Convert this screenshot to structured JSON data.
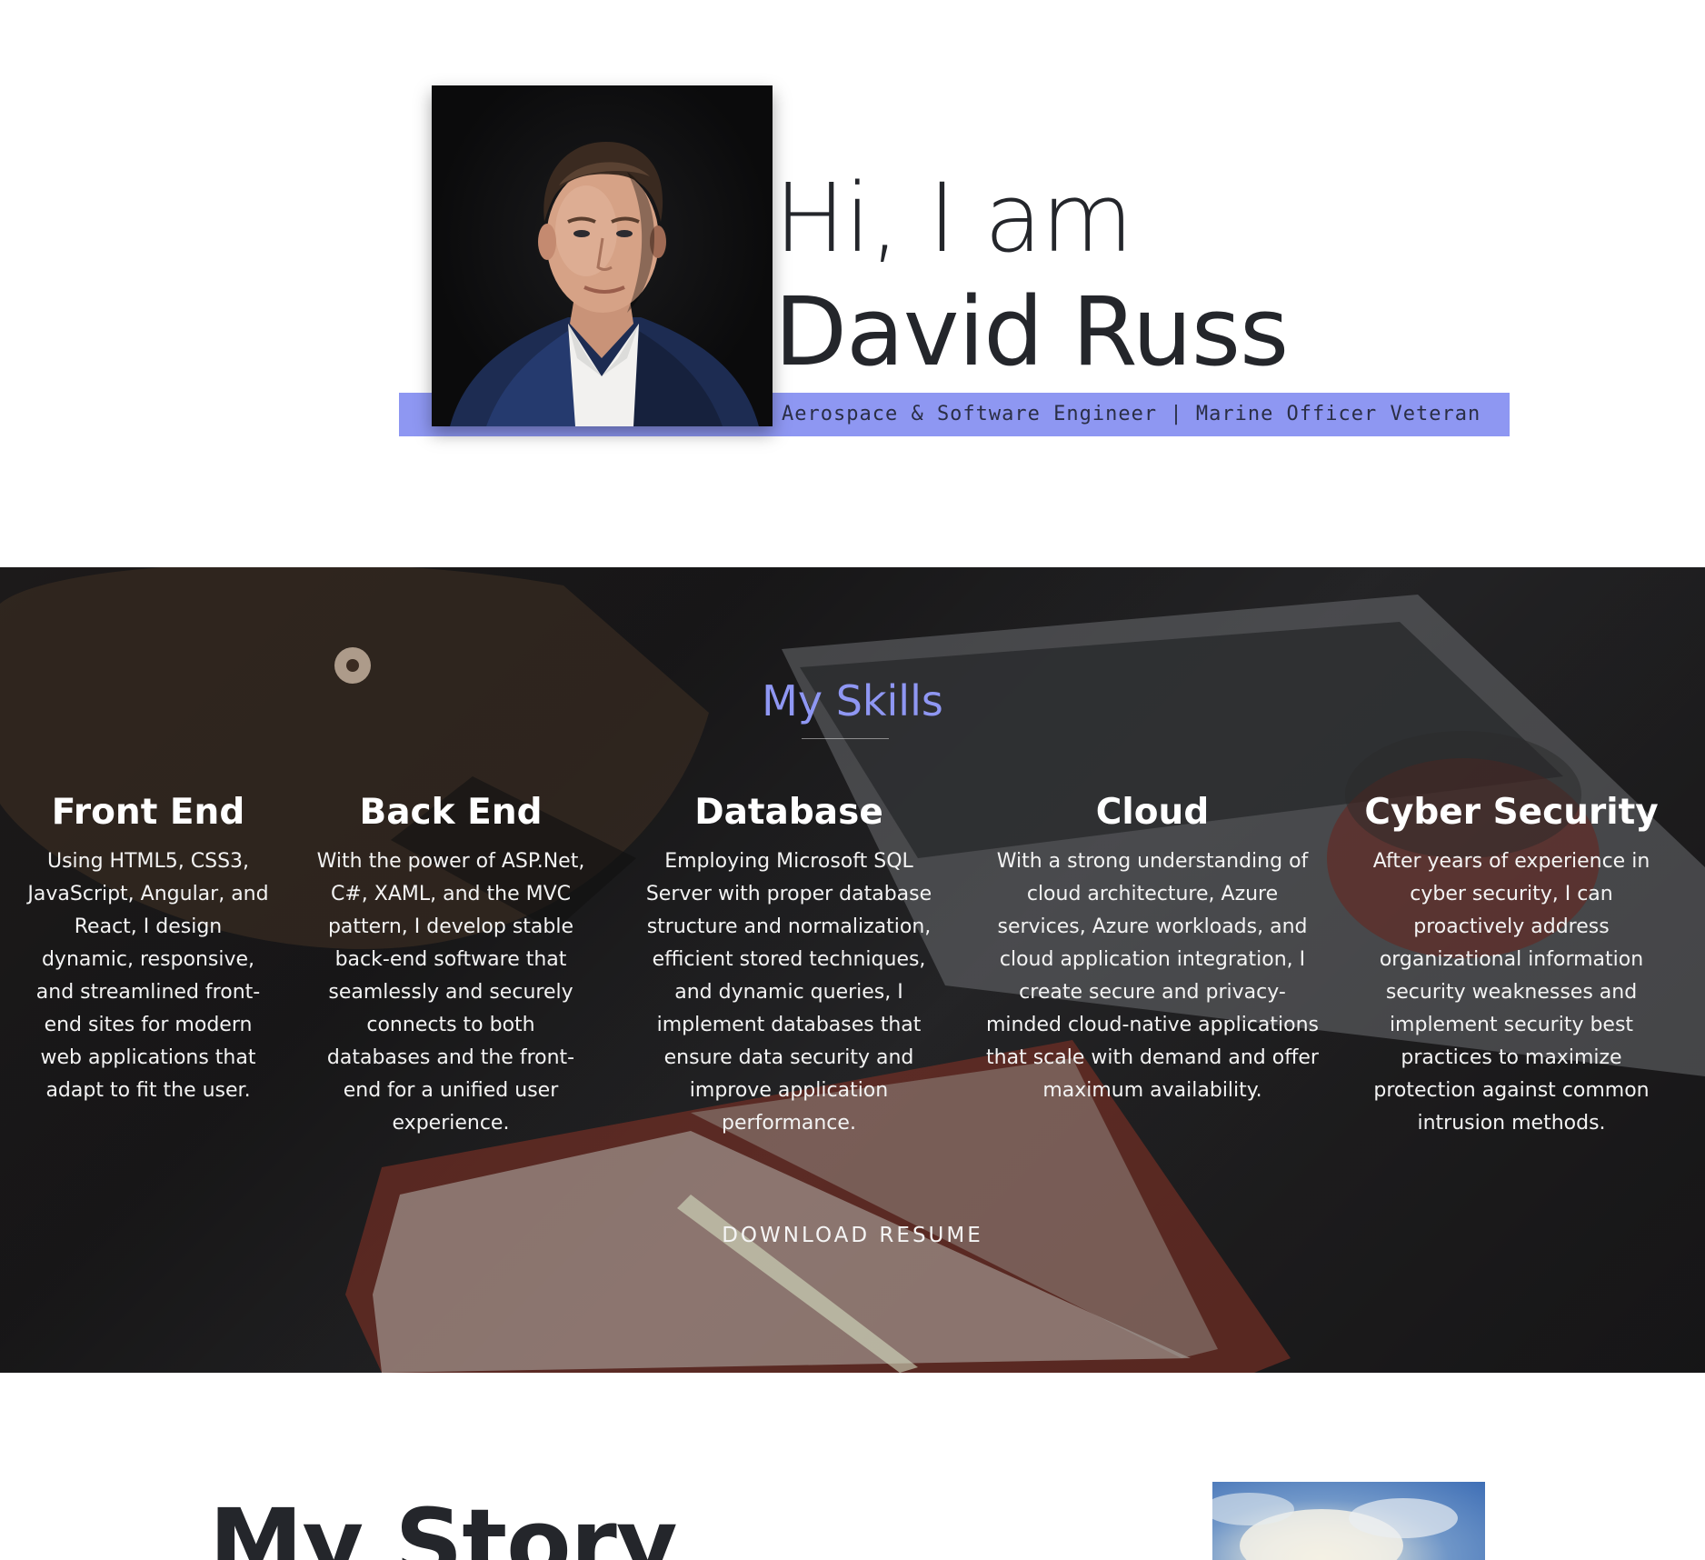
{
  "hero": {
    "greeting": "Hi, I am",
    "name": "David Russ",
    "tagline": "Aerospace & Software Engineer | Marine Officer Veteran",
    "accent_color": "#8e97f2"
  },
  "skills": {
    "title": "My Skills",
    "title_color": "#8f97f3",
    "items": [
      {
        "title": "Front End",
        "description": "Using HTML5, CSS3, JavaScript, Angular, and React, I design dynamic, responsive, and streamlined front-end sites for modern web applications that adapt to fit the user."
      },
      {
        "title": "Back End",
        "description": "With the power of ASP.Net, C#, XAML, and the MVC pattern, I develop stable back-end software that seamlessly and securely connects to both databases and the front-end for a unified user experience."
      },
      {
        "title": "Database",
        "description": "Employing Microsoft SQL Server with proper database structure and normalization, efficient stored techniques, and dynamic queries, I implement databases that ensure data security and improve application performance."
      },
      {
        "title": "Cloud",
        "description": "With a strong understanding of cloud architecture, Azure services, Azure workloads, and cloud application integration, I create secure and privacy-minded cloud-native applications that scale with demand and offer maximum availability."
      },
      {
        "title": "Cyber Security",
        "description": "After years of experience in cyber security, I can proactively address organizational information security weaknesses and implement security best practices to maximize protection against common intrusion methods."
      }
    ],
    "download_label": "DOWNLOAD RESUME"
  },
  "story": {
    "title": "My Story"
  }
}
